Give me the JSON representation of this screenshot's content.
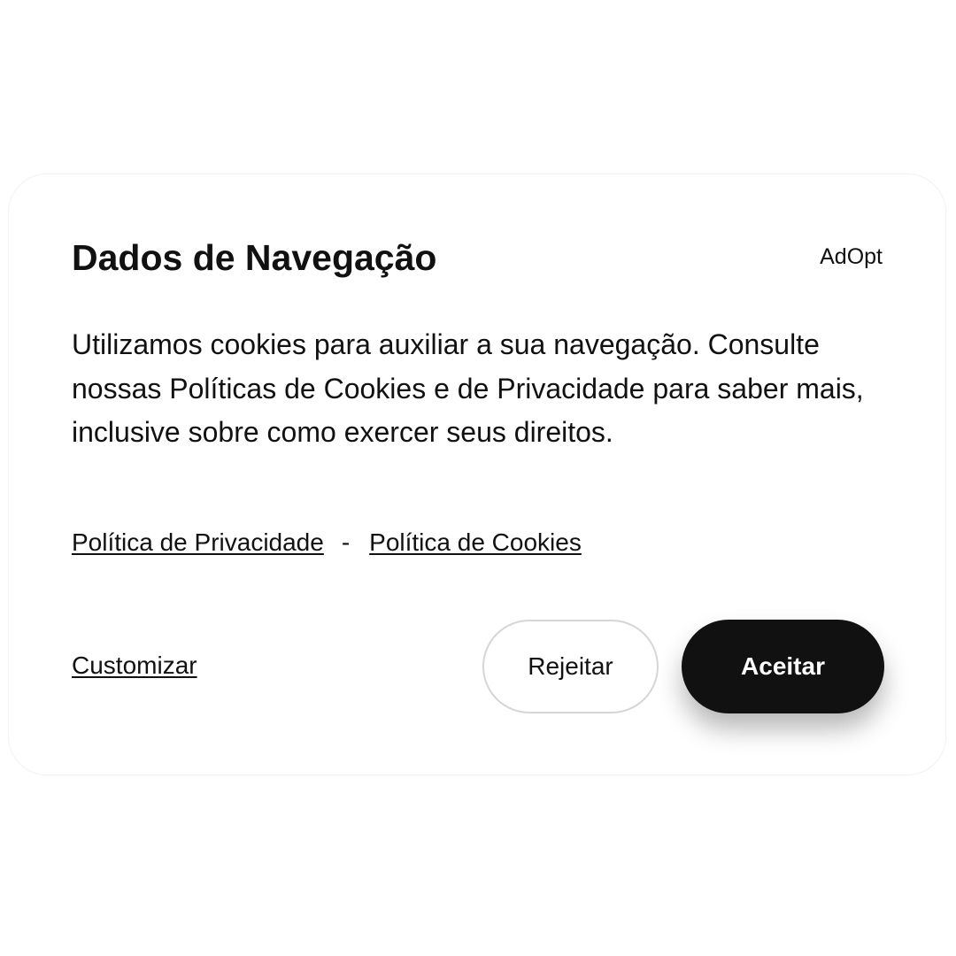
{
  "banner": {
    "title": "Dados de Navegação",
    "brand": "AdOpt",
    "body": "Utilizamos cookies para auxiliar a sua navegação. Consulte nossas Políticas de Cookies e de Privacidade para saber mais, inclusive sobre como exercer seus direitos.",
    "links": {
      "privacy": "Política de Privacidade",
      "separator": "-",
      "cookies": "Política de Cookies"
    },
    "customize_label": "Customizar",
    "reject_label": "Rejeitar",
    "accept_label": "Aceitar"
  },
  "colors": {
    "text": "#111111",
    "accept_background": "#111111",
    "accept_text": "#ffffff",
    "reject_border": "#d6d6d6",
    "card_background": "#ffffff"
  }
}
